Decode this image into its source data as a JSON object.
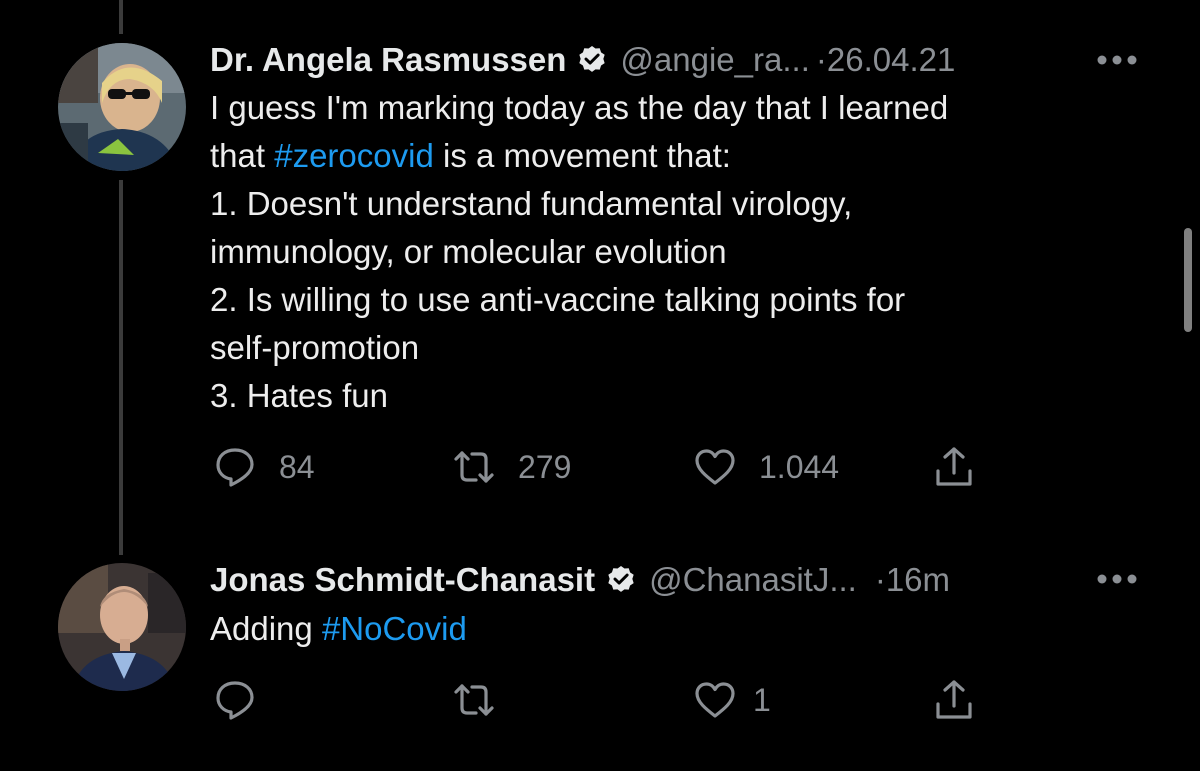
{
  "colors": {
    "background": "#000000",
    "text": "#e7e9ea",
    "muted": "#8b8f94",
    "hashtag": "#1d9bf0",
    "thread_line": "#3b3b3b"
  },
  "tweets": [
    {
      "author": "Dr. Angela Rasmussen",
      "handle": "@angie_ra...",
      "time": "26.04.21",
      "verified": true,
      "body": {
        "line1": "I guess I'm marking today as the day that I learned",
        "line2_prefix": "that ",
        "hashtag": "#zerocovid",
        "line2_suffix": " is a movement that:",
        "line3": "1. Doesn't understand fundamental virology,",
        "line4": "immunology, or molecular evolution",
        "line5": "2. Is willing to use anti-vaccine talking points for",
        "line6": "self-promotion",
        "line7": "3. Hates fun"
      },
      "actions": {
        "replies": "84",
        "retweets": "279",
        "likes": "1.044"
      }
    },
    {
      "author": "Jonas Schmidt-Chanasit",
      "handle": "@ChanasitJ...",
      "time": "16m",
      "verified": true,
      "body": {
        "prefix": "Adding ",
        "hashtag": "#NoCovid"
      },
      "actions": {
        "replies": "",
        "retweets": "",
        "likes": "1"
      }
    }
  ],
  "icons": {
    "reply": "reply-icon",
    "retweet": "retweet-icon",
    "like": "heart-icon",
    "share": "share-icon",
    "verified": "verified-badge-icon",
    "more": "more-options-icon"
  },
  "separator": "·"
}
